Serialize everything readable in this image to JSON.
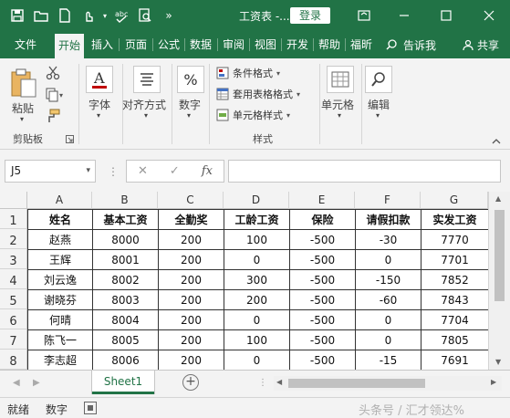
{
  "titlebar": {
    "title": "工资表 -...",
    "login_label": "登录",
    "bg_color": "#217346"
  },
  "tabs": [
    {
      "label": "文件"
    },
    {
      "label": "开始",
      "active": true
    },
    {
      "label": "插入"
    },
    {
      "label": "页面"
    },
    {
      "label": "公式"
    },
    {
      "label": "数据"
    },
    {
      "label": "审阅"
    },
    {
      "label": "视图"
    },
    {
      "label": "开发"
    },
    {
      "label": "帮助"
    },
    {
      "label": "福昕"
    }
  ],
  "tellme": {
    "label": "告诉我"
  },
  "share": {
    "label": "共享"
  },
  "ribbon": {
    "paste_label": "粘贴",
    "clipboard_label": "剪贴板",
    "font_label": "字体",
    "align_label": "对齐方式",
    "number_label": "数字",
    "cond_format_label": "条件格式",
    "table_format_label": "套用表格格式",
    "cell_style_label": "单元格样式",
    "styles_label": "样式",
    "cells_label": "单元格",
    "edit_label": "编辑"
  },
  "formula_bar": {
    "name_box": "J5",
    "formula": ""
  },
  "grid": {
    "columns": [
      "A",
      "B",
      "C",
      "D",
      "E",
      "F",
      "G"
    ],
    "rows": [
      "1",
      "2",
      "3",
      "4",
      "5",
      "6",
      "7",
      "8"
    ],
    "header": [
      "姓名",
      "基本工资",
      "全勤奖",
      "工龄工资",
      "保险",
      "请假扣款",
      "实发工资"
    ],
    "data": [
      [
        "赵燕",
        "8000",
        "200",
        "100",
        "-500",
        "-30",
        "7770"
      ],
      [
        "王辉",
        "8001",
        "200",
        "0",
        "-500",
        "0",
        "7701"
      ],
      [
        "刘云逸",
        "8002",
        "200",
        "300",
        "-500",
        "-150",
        "7852"
      ],
      [
        "谢晓芬",
        "8003",
        "200",
        "200",
        "-500",
        "-60",
        "7843"
      ],
      [
        "何晴",
        "8004",
        "200",
        "0",
        "-500",
        "0",
        "7704"
      ],
      [
        "陈飞一",
        "8005",
        "200",
        "100",
        "-500",
        "0",
        "7805"
      ],
      [
        "李志超",
        "8006",
        "200",
        "0",
        "-500",
        "-15",
        "7691"
      ]
    ]
  },
  "sheets": [
    {
      "label": "Sheet1",
      "active": true
    }
  ],
  "status": {
    "ready": "就绪",
    "number": "数字"
  },
  "watermark": "头条号 / 汇才领达%"
}
